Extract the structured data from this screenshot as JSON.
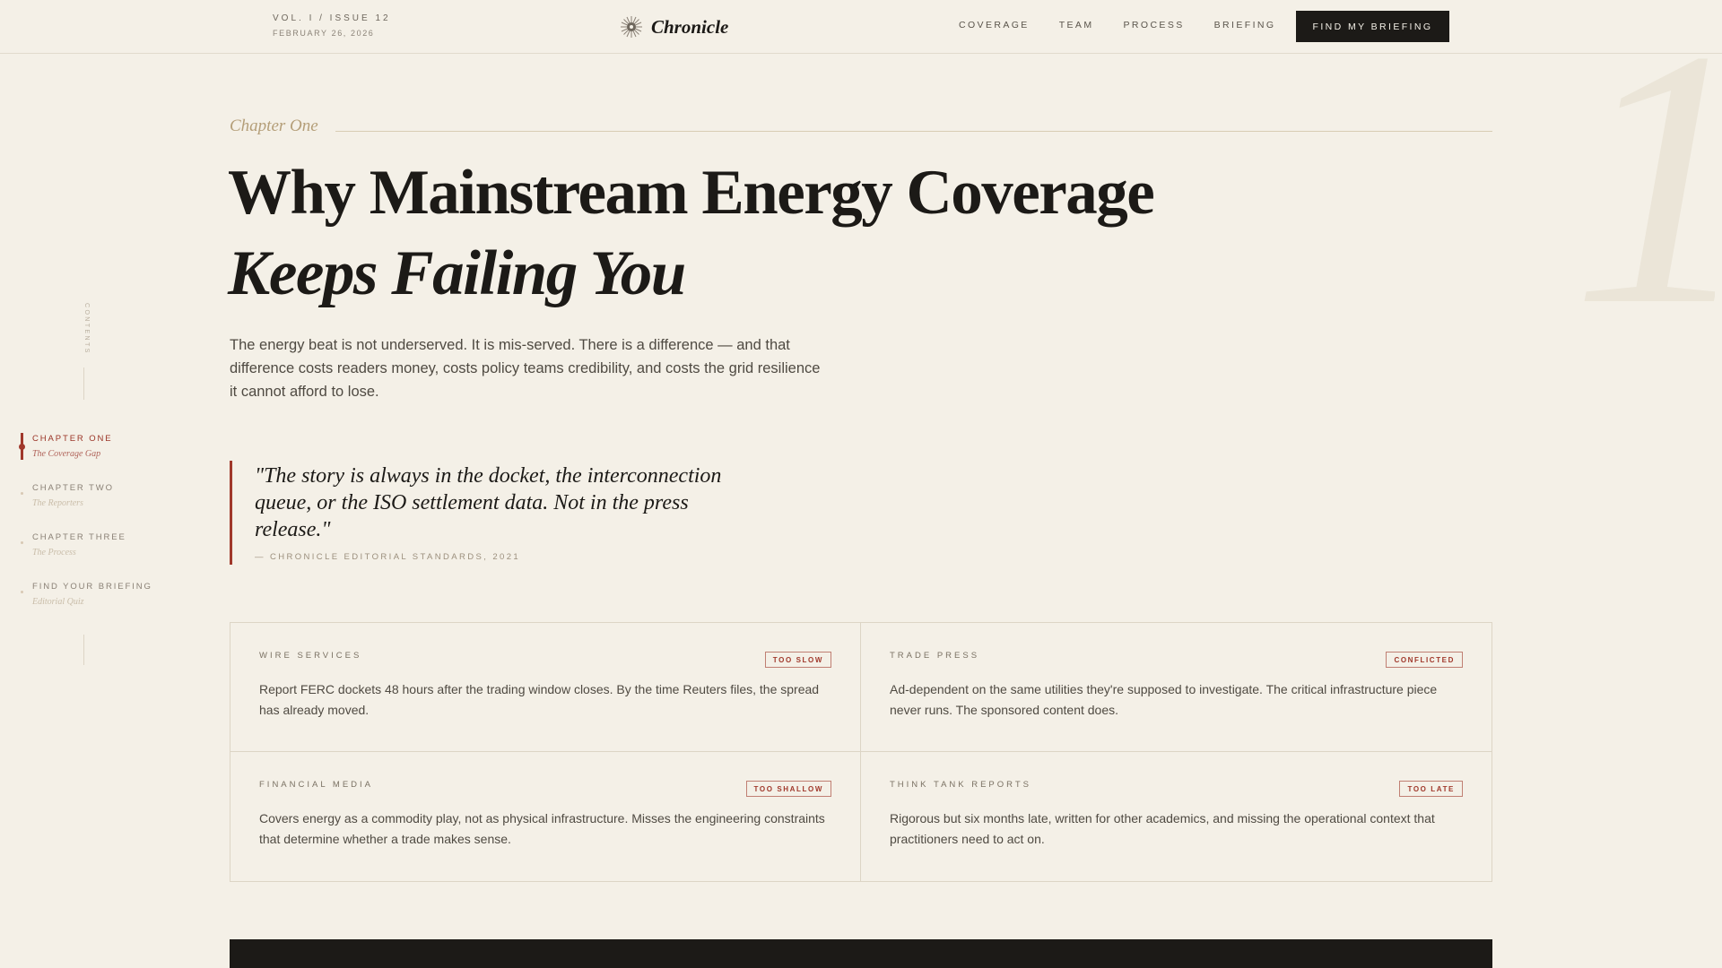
{
  "header": {
    "issue": "VOL. I / ISSUE 12",
    "date": "FEBRUARY 26, 2026",
    "brand": "Chronicle",
    "brand_icon": "sun-mark-icon",
    "nav": [
      "COVERAGE",
      "TEAM",
      "PROCESS",
      "BRIEFING"
    ],
    "cta": "FIND MY BRIEFING"
  },
  "rail": {
    "label": "CONTENTS",
    "items": [
      {
        "title": "CHAPTER ONE",
        "subtitle": "The Coverage Gap",
        "active": true
      },
      {
        "title": "CHAPTER TWO",
        "subtitle": "The Reporters",
        "active": false
      },
      {
        "title": "CHAPTER THREE",
        "subtitle": "The Process",
        "active": false
      },
      {
        "title": "FIND YOUR BRIEFING",
        "subtitle": "Editorial Quiz",
        "active": false
      }
    ]
  },
  "chapter": {
    "kicker": "Chapter One",
    "numeral": "1",
    "headline_1": "Why Mainstream Energy Coverage",
    "headline_2": "Keeps Failing You",
    "lede": "The energy beat is not underserved. It is mis-served. There is a difference — and that difference costs readers money, costs policy teams credibility, and costs the grid resilience it cannot afford to lose.",
    "quote": "\"The story is always in the docket, the interconnection queue, or the ISO settlement data. Not in the press release.\"",
    "quote_attribution": "— CHRONICLE EDITORIAL STANDARDS, 2021"
  },
  "sources": [
    {
      "label": "WIRE SERVICES",
      "badge": "TOO SLOW",
      "desc": "Report FERC dockets 48 hours after the trading window closes. By the time Reuters files, the spread has already moved."
    },
    {
      "label": "TRADE PRESS",
      "badge": "CONFLICTED",
      "desc": "Ad-dependent on the same utilities they're supposed to investigate. The critical infrastructure piece never runs. The sponsored content does."
    },
    {
      "label": "FINANCIAL MEDIA",
      "badge": "TOO SHALLOW",
      "desc": "Covers energy as a commodity play, not as physical infrastructure. Misses the engineering constraints that determine whether a trade makes sense."
    },
    {
      "label": "THINK TANK REPORTS",
      "badge": "TOO LATE",
      "desc": "Rigorous but six months late, written for other academics, and missing the operational context that practitioners need to act on."
    }
  ],
  "colors": {
    "background": "#f4f0e7",
    "ink": "#1c1a17",
    "accent_red": "#a0382b",
    "gold": "#b49e78"
  }
}
